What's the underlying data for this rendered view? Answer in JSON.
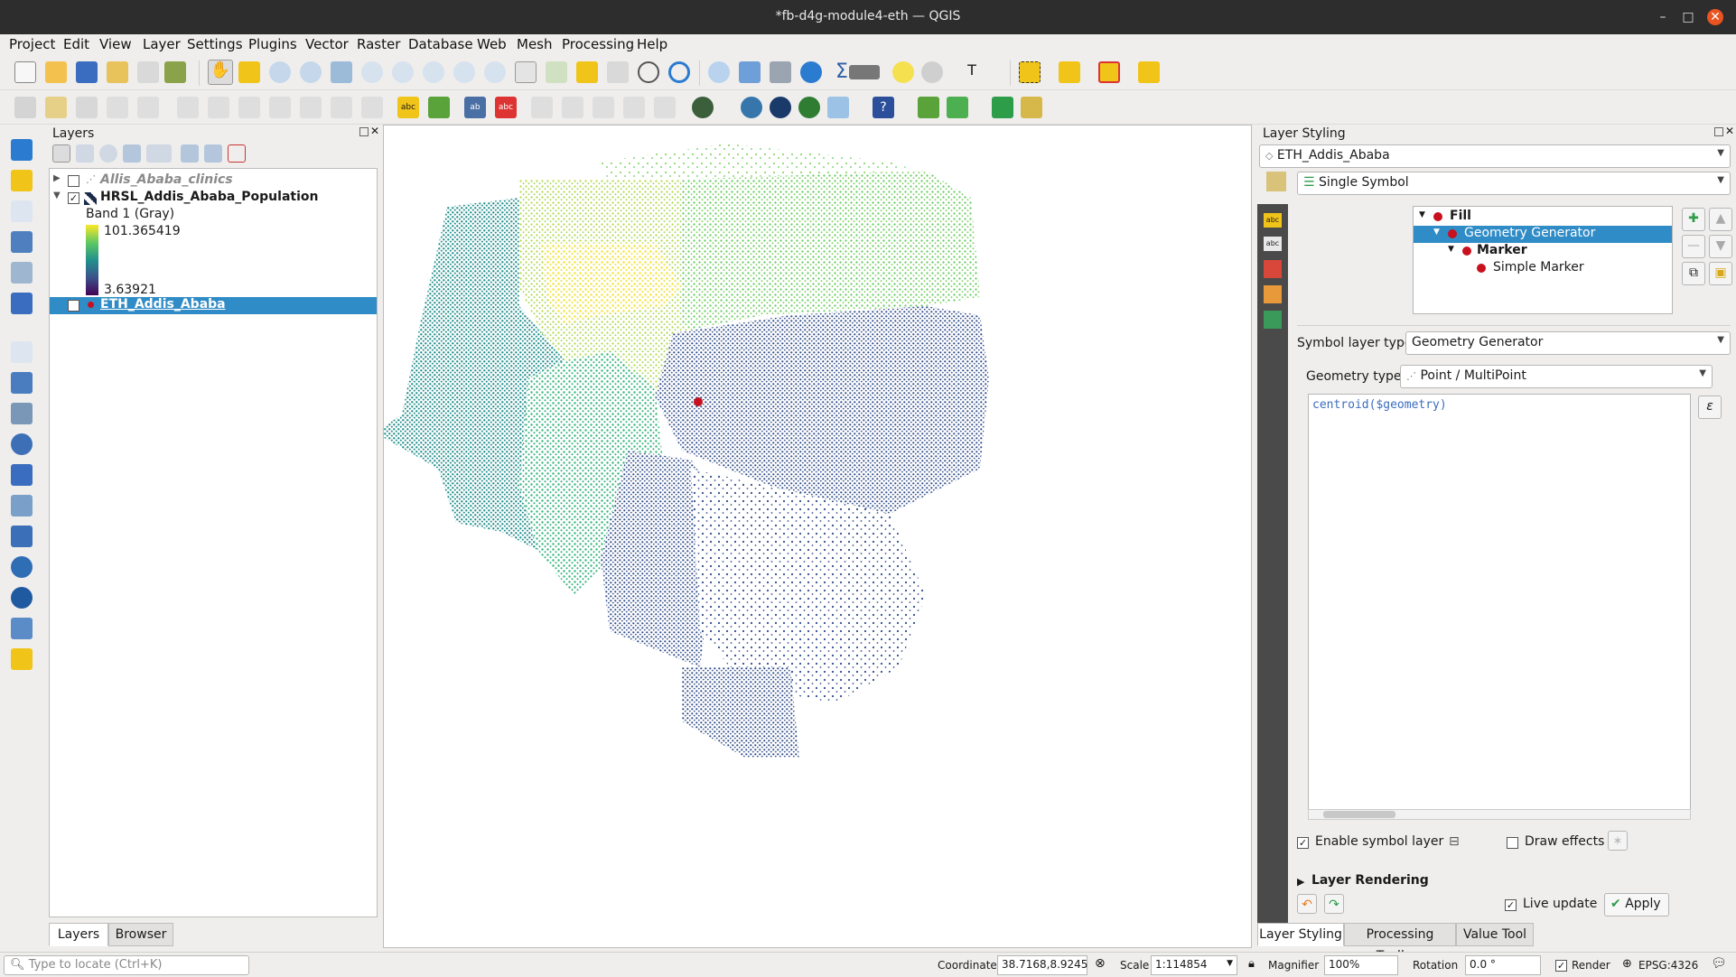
{
  "window": {
    "title": "*fb-d4g-module4-eth — QGIS"
  },
  "menu": [
    "Project",
    "Edit",
    "View",
    "Layer",
    "Settings",
    "Plugins",
    "Vector",
    "Raster",
    "Database",
    "Web",
    "Mesh",
    "Processing",
    "Help"
  ],
  "layers_panel": {
    "title": "Layers",
    "layers": [
      {
        "name": "Allis_Ababa_clinics",
        "checked": false
      },
      {
        "name": "HRSL_Addis_Ababa_Population",
        "checked": true
      },
      {
        "name": "ETH_Addis_Ababa",
        "checked": true
      }
    ],
    "band_label": "Band 1 (Gray)",
    "legend_max": "101.365419",
    "legend_min": "3.63921",
    "check_mark": "✓",
    "tabs": [
      "Layers",
      "Browser"
    ]
  },
  "styling": {
    "title": "Layer Styling",
    "layer_select": "ETH_Addis_Ababa",
    "renderer": "Single Symbol",
    "symbol_tree": [
      "Fill",
      "Geometry Generator",
      "Marker",
      "Simple Marker"
    ],
    "symbol_layer_type_label": "Symbol layer type",
    "symbol_layer_type": "Geometry Generator",
    "geometry_type_label": "Geometry type",
    "geometry_type": "Point / MultiPoint",
    "expression": "centroid($geometry)",
    "enable_symbol_layer": "Enable symbol layer",
    "draw_effects": "Draw effects",
    "layer_rendering": "Layer Rendering",
    "live_update": "Live update",
    "apply": "Apply",
    "bottom_tabs": [
      "Layer Styling",
      "Processing Toolbox",
      "Value Tool"
    ]
  },
  "statusbar": {
    "locator_placeholder": "Type to locate (Ctrl+K)",
    "coordinate_label": "Coordinate",
    "coordinate": "38.7168,8.9245",
    "scale_label": "Scale",
    "scale": "1:114854",
    "magnifier_label": "Magnifier",
    "magnifier": "100%",
    "rotation_label": "Rotation",
    "rotation": "0.0 °",
    "render_label": "Render",
    "crs": "EPSG:4326"
  },
  "colors": {
    "selection": "#308cc6",
    "viridis_yellow": "#fde725",
    "viridis_green": "#5ec962",
    "viridis_teal": "#21918c",
    "viridis_navy": "#3b528b",
    "viridis_purple": "#440154"
  }
}
